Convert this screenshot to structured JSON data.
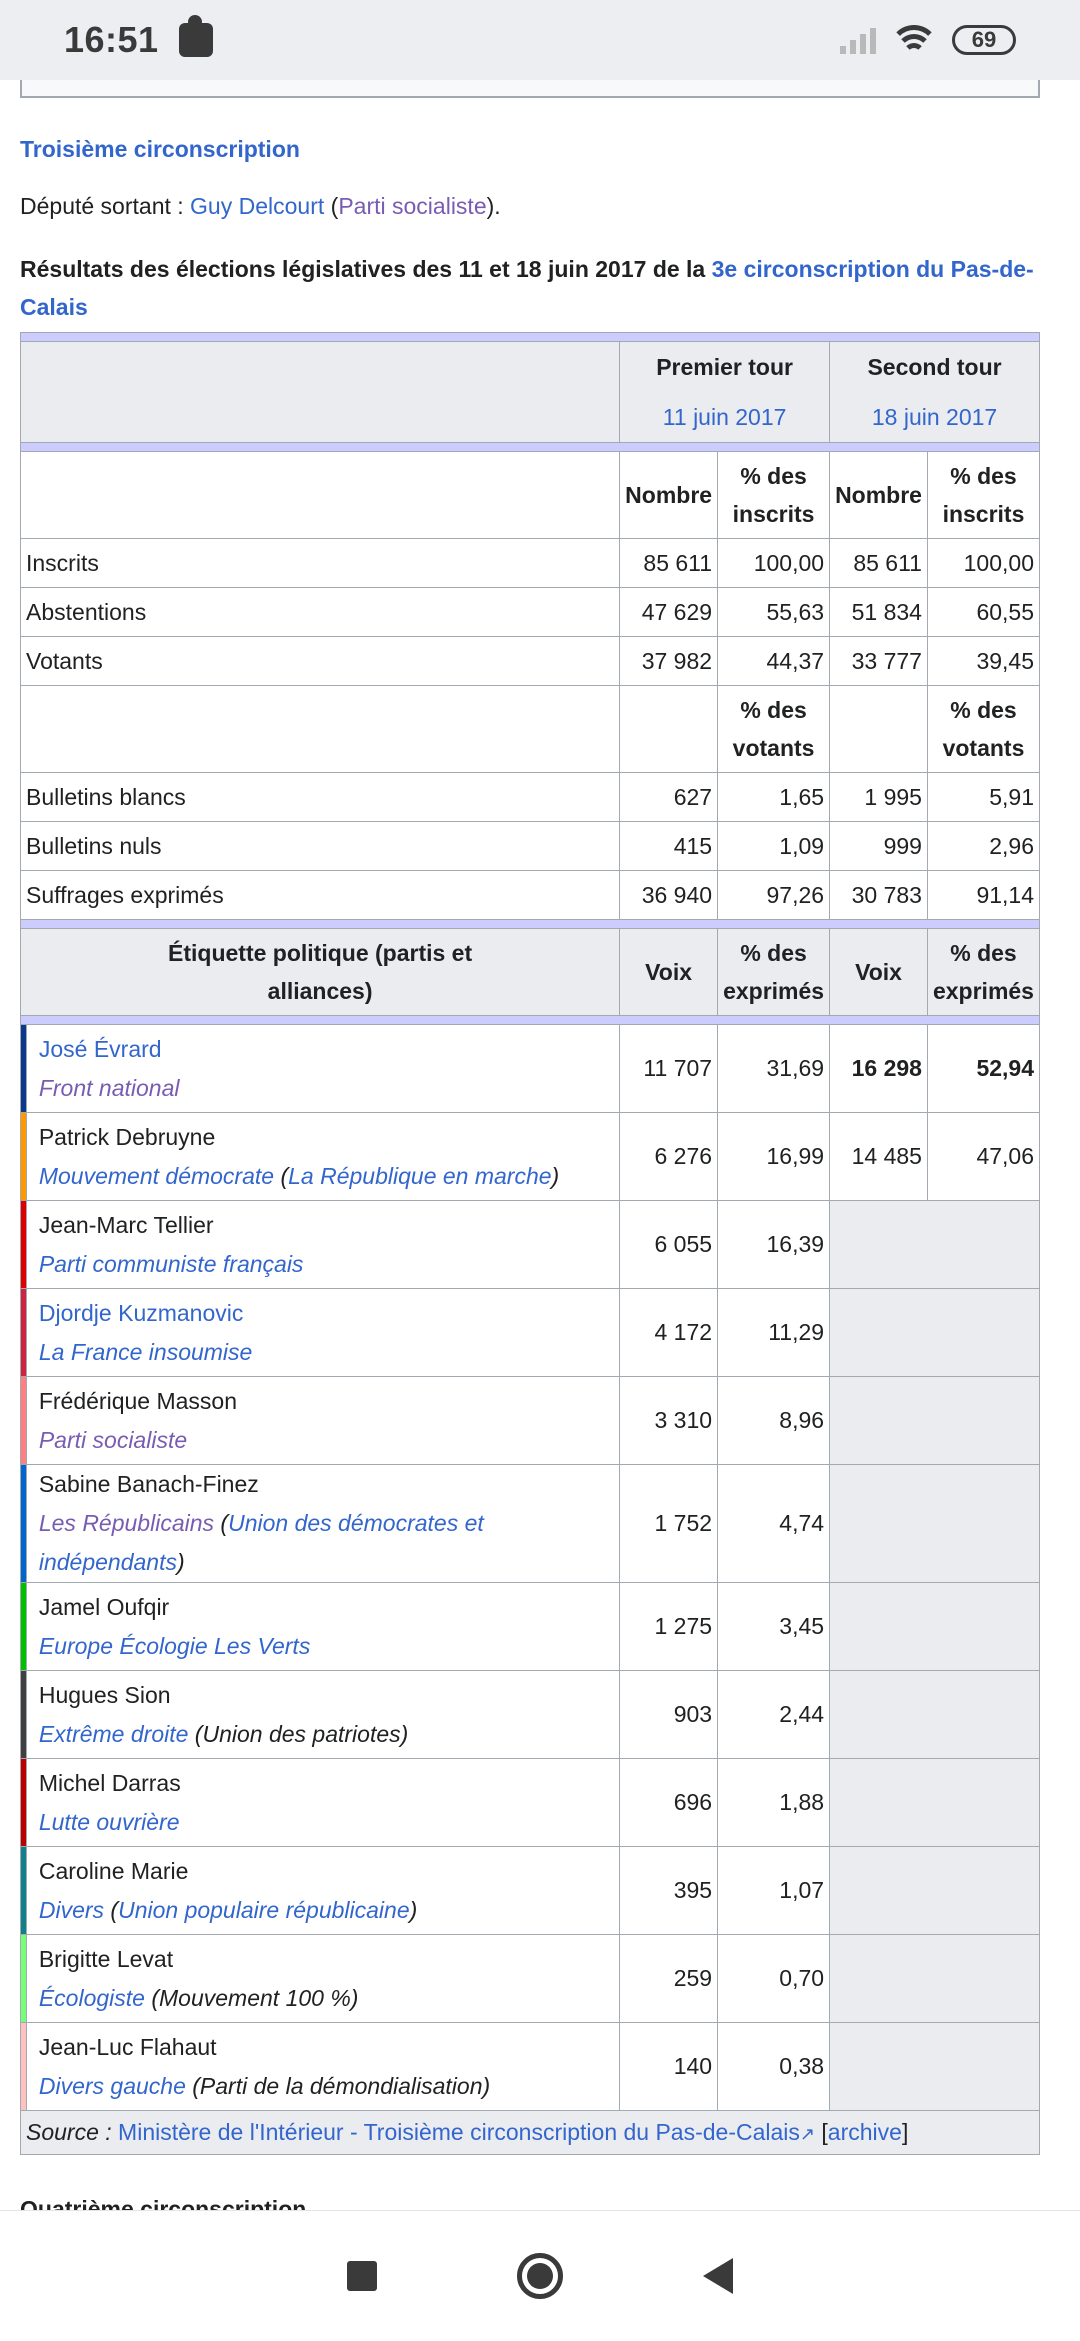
{
  "status": {
    "time": "16:51",
    "battery": "69"
  },
  "section": {
    "heading": "Troisième circonscription",
    "incumbent_prefix": "Député sortant : ",
    "incumbent_name": "Guy Delcourt",
    "incumbent_open": " (",
    "incumbent_party": "Parti socialiste",
    "incumbent_close": ")."
  },
  "caption": {
    "text": "Résultats des élections législatives des 11 et 18 juin 2017 de la ",
    "link": "3e circonscription du Pas-de-Calais"
  },
  "table": {
    "round1": "Premier tour",
    "round1_date": "11 juin 2017",
    "round2": "Second tour",
    "round2_date": "18 juin 2017",
    "col_nombre": "Nombre",
    "col_pct_inscrits": "% des inscrits",
    "col_pct_votants": "% des votants",
    "col_etiquette": "Étiquette politique (partis et alliances)",
    "col_voix": "Voix",
    "col_pct_exprimes": "% des exprimés",
    "stats1": [
      {
        "label": "Inscrits",
        "n1": "85 611",
        "p1": "100,00",
        "n2": "85 611",
        "p2": "100,00"
      },
      {
        "label": "Abstentions",
        "n1": "47 629",
        "p1": "55,63",
        "n2": "51 834",
        "p2": "60,55"
      },
      {
        "label": "Votants",
        "n1": "37 982",
        "p1": "44,37",
        "n2": "33 777",
        "p2": "39,45"
      }
    ],
    "stats2": [
      {
        "label": "Bulletins blancs",
        "n1": "627",
        "p1": "1,65",
        "n2": "1 995",
        "p2": "5,91"
      },
      {
        "label": "Bulletins nuls",
        "n1": "415",
        "p1": "1,09",
        "n2": "999",
        "p2": "2,96"
      },
      {
        "label": "Suffrages exprimés",
        "n1": "36 940",
        "p1": "97,26",
        "n2": "30 783",
        "p2": "91,14"
      }
    ],
    "candidates": [
      {
        "name": "José Évrard",
        "party": "Front national",
        "extra": "",
        "v1": "11 707",
        "p1": "31,69",
        "v2": "16 298",
        "p2": "52,94",
        "color": "#0d378a",
        "name_link": true
      },
      {
        "name": "Patrick Debruyne",
        "party": "Mouvement démocrate",
        "extra": "La République en marche",
        "v1": "6 276",
        "p1": "16,99",
        "v2": "14 485",
        "p2": "47,06",
        "color": "#ff9900",
        "name_link": false
      },
      {
        "name": "Jean-Marc Tellier",
        "party": "Parti communiste français",
        "extra": "",
        "v1": "6 055",
        "p1": "16,39",
        "color": "#dd0000",
        "name_link": false
      },
      {
        "name": "Djordje Kuzmanovic",
        "party": "La France insoumise",
        "extra": "",
        "v1": "4 172",
        "p1": "11,29",
        "color": "#cc2443",
        "name_link": true
      },
      {
        "name": "Frédérique Masson",
        "party": "Parti socialiste",
        "extra": "",
        "v1": "3 310",
        "p1": "8,96",
        "color": "#ff8080",
        "name_link": false
      },
      {
        "name": "Sabine Banach-Finez",
        "party": "Les Républicains",
        "extra": "Union des démocrates et indépendants",
        "v1": "1 752",
        "p1": "4,74",
        "color": "#0066cc",
        "name_link": false
      },
      {
        "name": "Jamel Oufqir",
        "party": "Europe Écologie Les Verts",
        "extra": "",
        "v1": "1 275",
        "p1": "3,45",
        "color": "#00c000",
        "name_link": false
      },
      {
        "name": "Hugues Sion",
        "party": "Extrême droite",
        "extra": "Union des patriotes",
        "v1": "903",
        "p1": "2,44",
        "color": "#404040",
        "name_link": false
      },
      {
        "name": "Michel Darras",
        "party": "Lutte ouvrière",
        "extra": "",
        "v1": "696",
        "p1": "1,88",
        "color": "#bb0000",
        "name_link": false
      },
      {
        "name": "Caroline Marie",
        "party": "Divers",
        "extra": "Union populaire républicaine",
        "v1": "395",
        "p1": "1,07",
        "color": "#118088",
        "name_link": false
      },
      {
        "name": "Brigitte Levat",
        "party": "Écologiste",
        "extra": "Mouvement 100 %",
        "v1": "259",
        "p1": "0,70",
        "color": "#77ff77",
        "name_link": false
      },
      {
        "name": "Jean-Luc Flahaut",
        "party": "Divers gauche",
        "extra": "Parti de la démondialisation",
        "v1": "140",
        "p1": "0,38",
        "color": "#ffc0c0",
        "name_link": false
      }
    ],
    "source_prefix": "Source : ",
    "source_link": "Ministère de l'Intérieur - Troisième circonscription du Pas-de-Calais",
    "archive": "archive"
  },
  "next_heading": "Quatrième circonscription"
}
